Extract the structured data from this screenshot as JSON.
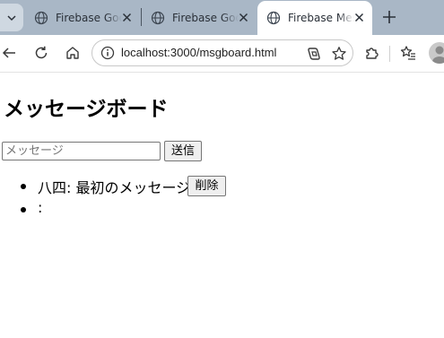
{
  "browser": {
    "tabs": [
      {
        "title": "Firebase Goo",
        "active": false
      },
      {
        "title": "Firebase Goo",
        "active": false
      },
      {
        "title": "Firebase Mes",
        "active": true
      }
    ],
    "address": "localhost:3000/msgboard.html"
  },
  "page": {
    "title": "メッセージボード",
    "input_placeholder": "メッセージ",
    "input_value": "",
    "send_label": "送信",
    "messages": [
      {
        "text": "八四: 最初のメッセージ",
        "delete_label": "削除"
      },
      {
        "text": ":"
      }
    ]
  },
  "colors": {
    "tabstrip": "#a9b7c6",
    "active_tab": "#ffffff",
    "button_bg": "#efefef"
  }
}
